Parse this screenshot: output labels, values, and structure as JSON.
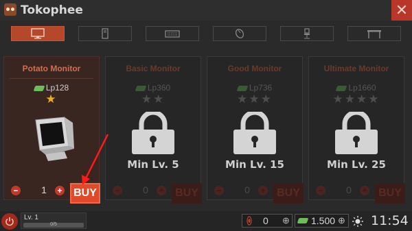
{
  "titlebar": {
    "title": "Tokophee",
    "close_icon": "close-icon"
  },
  "tabs": [
    {
      "name": "monitor",
      "icon": "monitor-icon",
      "active": true
    },
    {
      "name": "computer-case",
      "icon": "pc-case-icon",
      "active": false
    },
    {
      "name": "keyboard",
      "icon": "keyboard-icon",
      "active": false
    },
    {
      "name": "mouse",
      "icon": "mouse-icon",
      "active": false
    },
    {
      "name": "chair",
      "icon": "chair-icon",
      "active": false
    },
    {
      "name": "desk",
      "icon": "desk-icon",
      "active": false
    }
  ],
  "cards": [
    {
      "title": "Potato Monitor",
      "price": "Lp128",
      "stars": "★",
      "quantity": "1",
      "buy": "BUY",
      "locked": false
    },
    {
      "title": "Basic Monitor",
      "price": "Lp360",
      "stars": "★★",
      "quantity": "0",
      "buy": "BUY",
      "locked": true,
      "min_level": "Min Lv. 5"
    },
    {
      "title": "Good Monitor",
      "price": "Lp736",
      "stars": "★★★",
      "quantity": "0",
      "buy": "BUY",
      "locked": true,
      "min_level": "Min Lv. 15"
    },
    {
      "title": "Ultimate Monitor",
      "price": "Lp1660",
      "stars": "★★★★",
      "quantity": "0",
      "buy": "BUY",
      "locked": true,
      "min_level": "Min Lv. 25"
    }
  ],
  "bottombar": {
    "level": "Lv. 1",
    "xp": "0/5",
    "gems": "0",
    "money": "1.500",
    "time": "11:54"
  },
  "colors": {
    "accent": "#e04a2a",
    "star": "#e8b020",
    "money": "#6dbe5a"
  }
}
